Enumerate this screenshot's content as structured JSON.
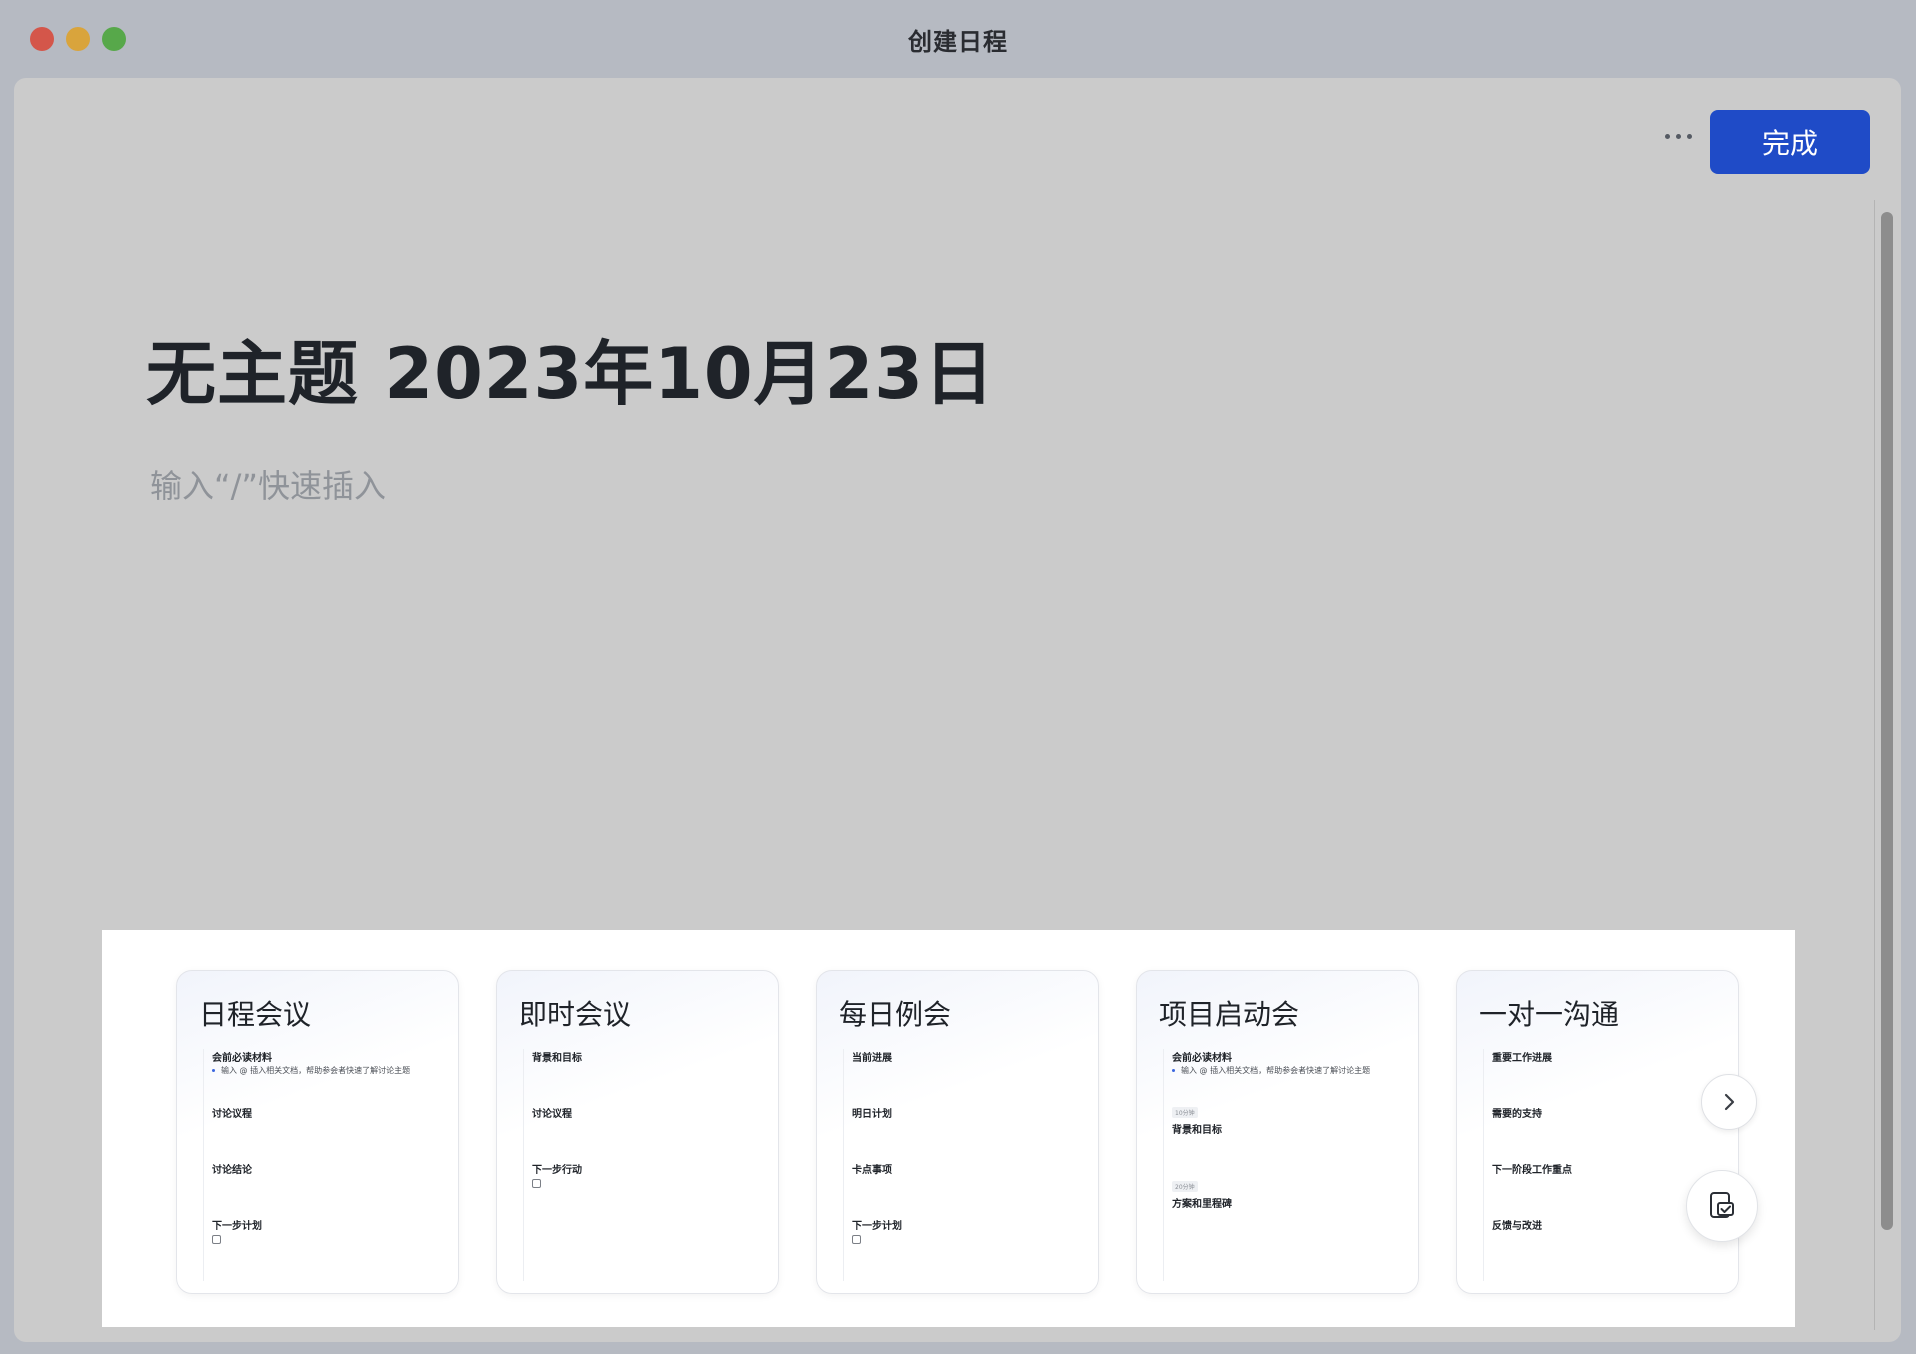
{
  "window": {
    "title": "创建日程"
  },
  "toolbar": {
    "done_label": "完成"
  },
  "document": {
    "title": "无主题 2023年10月23日",
    "placeholder": "输入“/”快速插入"
  },
  "templates": [
    {
      "title": "日程会议",
      "sections": [
        {
          "label": "会前必读材料",
          "note": "输入 @ 插入相关文档，帮助参会者快速了解讨论主题"
        },
        {
          "label": "讨论议程"
        },
        {
          "label": "讨论结论"
        },
        {
          "label": "下一步计划",
          "checkbox": true
        }
      ]
    },
    {
      "title": "即时会议",
      "sections": [
        {
          "label": "背景和目标"
        },
        {
          "label": "讨论议程"
        },
        {
          "label": "下一步行动",
          "checkbox": true
        }
      ]
    },
    {
      "title": "每日例会",
      "sections": [
        {
          "label": "当前进展"
        },
        {
          "label": "明日计划"
        },
        {
          "label": "卡点事项"
        },
        {
          "label": "下一步计划",
          "checkbox": true
        }
      ]
    },
    {
      "title": "项目启动会",
      "sections": [
        {
          "label": "会前必读材料",
          "note": "输入 @ 插入相关文档，帮助参会者快速了解讨论主题"
        },
        {
          "label": "背景和目标",
          "tag": "10分钟"
        },
        {
          "label": "方案和里程碑",
          "tag": "20分钟"
        }
      ]
    },
    {
      "title": "一对一沟通",
      "sections": [
        {
          "label": "重要工作进展"
        },
        {
          "label": "需要的支持"
        },
        {
          "label": "下一阶段工作重点"
        },
        {
          "label": "反馈与改进"
        }
      ]
    }
  ],
  "icons": {
    "close": "close-window-icon",
    "minimize": "minimize-window-icon",
    "maximize": "maximize-window-icon",
    "more": "more-options-icon",
    "next": "chevron-right-icon",
    "template_fab": "template-icon"
  },
  "colors": {
    "accent": "#1f4bc7",
    "window_bg": "#b6bac2",
    "sheet_bg": "#cbcbcb"
  }
}
